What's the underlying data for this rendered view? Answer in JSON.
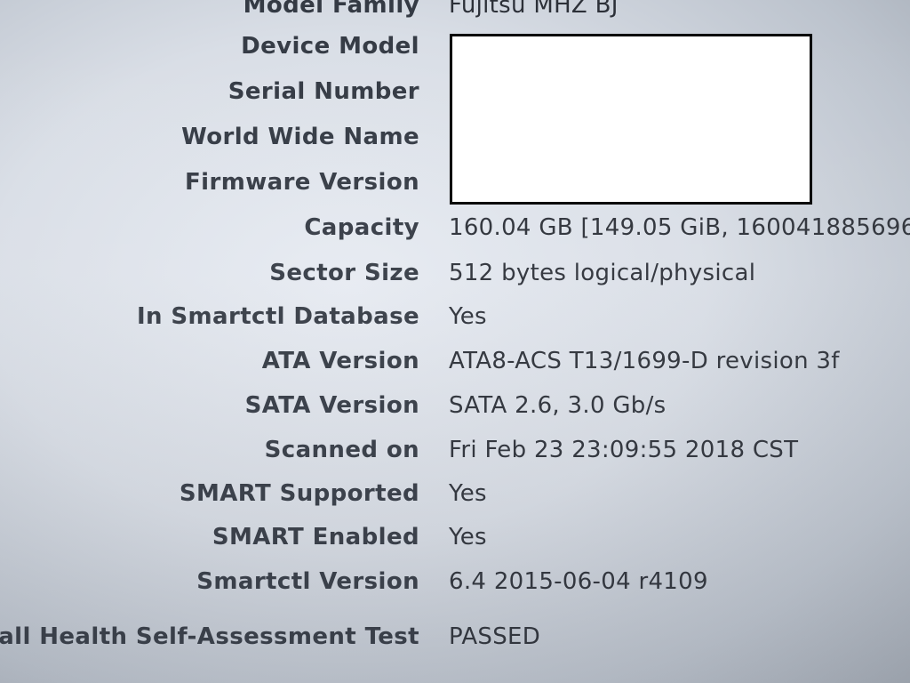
{
  "rows": [
    {
      "label": "Model Family",
      "value": "Fujitsu MHZ BJ"
    },
    {
      "label": "Device Model",
      "value": ""
    },
    {
      "label": "Serial Number",
      "value": ""
    },
    {
      "label": "World Wide Name",
      "value": ""
    },
    {
      "label": "Firmware Version",
      "value": ""
    },
    {
      "label": "Capacity",
      "value": "160.04 GB [149.05 GiB, 160041885696"
    },
    {
      "label": "Sector Size",
      "value": "512 bytes logical/physical"
    },
    {
      "label": "In Smartctl Database",
      "value": "Yes"
    },
    {
      "label": "ATA Version",
      "value": "ATA8-ACS T13/1699-D revision 3f"
    },
    {
      "label": "SATA Version",
      "value": "SATA 2.6, 3.0 Gb/s"
    },
    {
      "label": "Scanned on",
      "value": "Fri Feb 23 23:09:55 2018 CST"
    },
    {
      "label": "SMART Supported",
      "value": "Yes"
    },
    {
      "label": "SMART Enabled",
      "value": "Yes"
    },
    {
      "label": "Smartctl Version",
      "value": "6.4 2015-06-04 r4109"
    },
    {
      "label": "rall Health Self-Assessment Test",
      "value": "PASSED"
    }
  ],
  "colors": {
    "label": "#343a44",
    "value": "#2c3038",
    "redaction": "#ffffff"
  }
}
